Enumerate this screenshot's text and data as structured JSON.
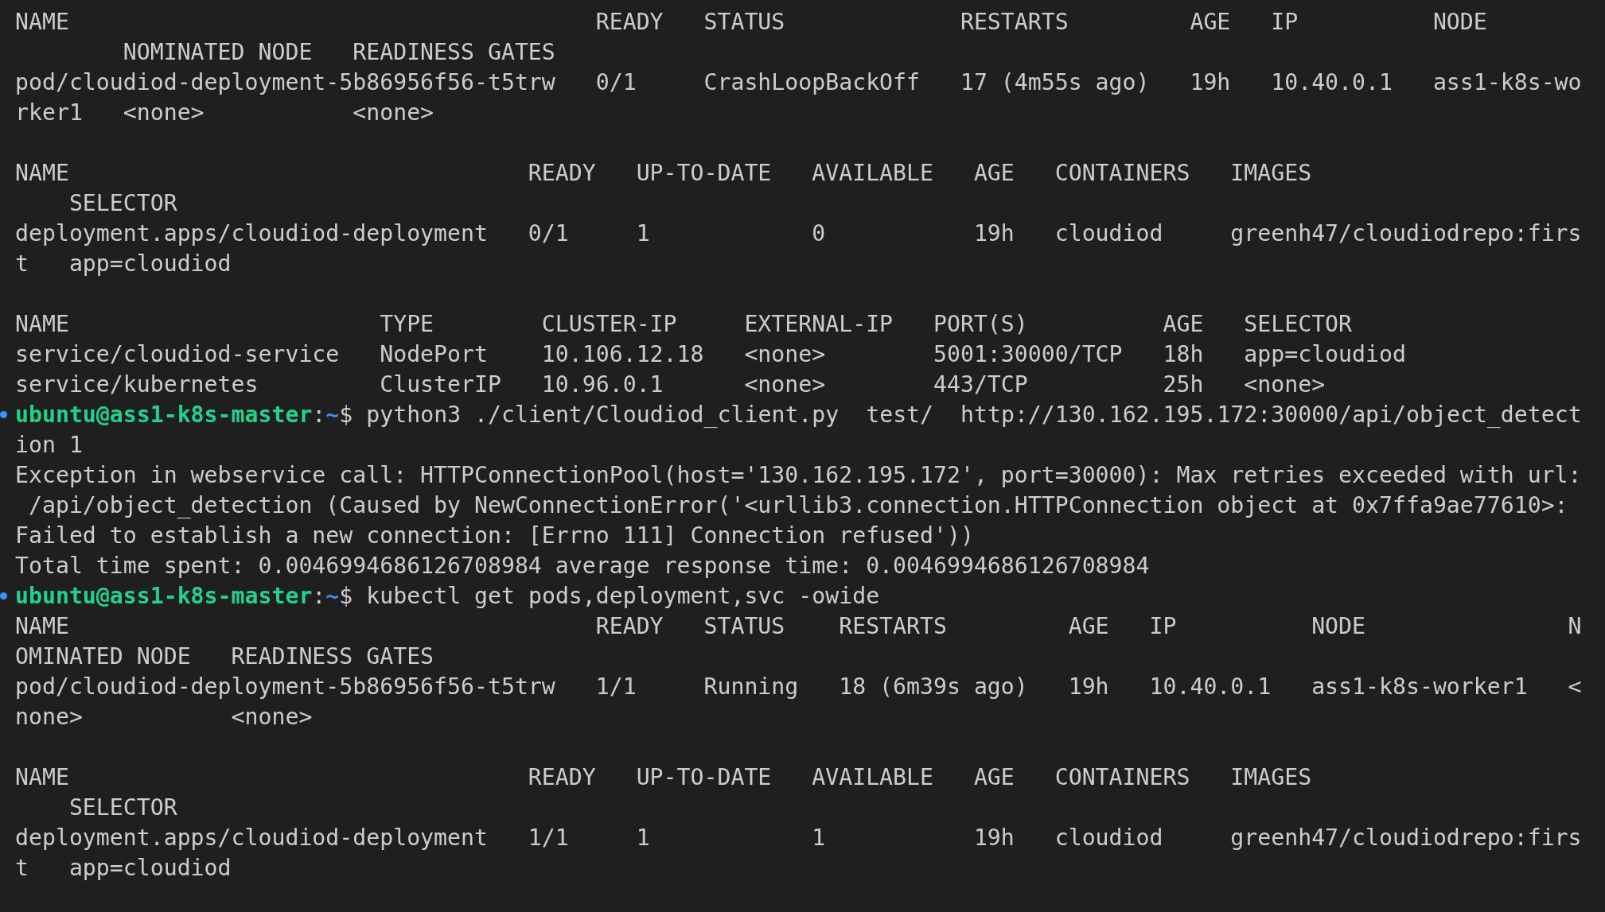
{
  "terminal": {
    "lines": [
      {
        "kind": "output",
        "text": "NAME                                       READY   STATUS             RESTARTS         AGE   IP          NODE"
      },
      {
        "kind": "output",
        "text": "        NOMINATED NODE   READINESS GATES"
      },
      {
        "kind": "output",
        "text": "pod/cloudiod-deployment-5b86956f56-t5trw   0/1     CrashLoopBackOff   17 (4m55s ago)   19h   10.40.0.1   ass1-k8s-wo"
      },
      {
        "kind": "output",
        "text": "rker1   <none>           <none>"
      },
      {
        "kind": "blank"
      },
      {
        "kind": "output",
        "text": "NAME                                  READY   UP-TO-DATE   AVAILABLE   AGE   CONTAINERS   IMAGES"
      },
      {
        "kind": "output",
        "text": "    SELECTOR"
      },
      {
        "kind": "output",
        "text": "deployment.apps/cloudiod-deployment   0/1     1            0           19h   cloudiod     greenh47/cloudiodrepo:firs"
      },
      {
        "kind": "output",
        "text": "t   app=cloudiod"
      },
      {
        "kind": "blank"
      },
      {
        "kind": "output",
        "text": "NAME                       TYPE        CLUSTER-IP     EXTERNAL-IP   PORT(S)          AGE   SELECTOR"
      },
      {
        "kind": "output",
        "text": "service/cloudiod-service   NodePort    10.106.12.18   <none>        5001:30000/TCP   18h   app=cloudiod"
      },
      {
        "kind": "output",
        "text": "service/kubernetes         ClusterIP   10.96.0.1      <none>        443/TCP          25h   <none>"
      },
      {
        "kind": "prompt",
        "user": "ubuntu@ass1-k8s-master",
        "separator": ":",
        "path": "~",
        "symbol": "$",
        "command": "python3 ./client/Cloudiod_client.py  test/  http://130.162.195.172:30000/api/object_detect"
      },
      {
        "kind": "output",
        "text": "ion 1"
      },
      {
        "kind": "output",
        "text": "Exception in webservice call: HTTPConnectionPool(host='130.162.195.172', port=30000): Max retries exceeded with url:"
      },
      {
        "kind": "output",
        "text": " /api/object_detection (Caused by NewConnectionError('<urllib3.connection.HTTPConnection object at 0x7ffa9ae77610>:"
      },
      {
        "kind": "output",
        "text": "Failed to establish a new connection: [Errno 111] Connection refused'))"
      },
      {
        "kind": "output",
        "text": "Total time spent: 0.0046994686126708984 average response time: 0.0046994686126708984"
      },
      {
        "kind": "prompt",
        "user": "ubuntu@ass1-k8s-master",
        "separator": ":",
        "path": "~",
        "symbol": "$",
        "command": "kubectl get pods,deployment,svc -owide"
      },
      {
        "kind": "output",
        "text": "NAME                                       READY   STATUS    RESTARTS         AGE   IP          NODE               N"
      },
      {
        "kind": "output",
        "text": "OMINATED NODE   READINESS GATES"
      },
      {
        "kind": "output",
        "text": "pod/cloudiod-deployment-5b86956f56-t5trw   1/1     Running   18 (6m39s ago)   19h   10.40.0.1   ass1-k8s-worker1   <"
      },
      {
        "kind": "output",
        "text": "none>           <none>"
      },
      {
        "kind": "blank"
      },
      {
        "kind": "output",
        "text": "NAME                                  READY   UP-TO-DATE   AVAILABLE   AGE   CONTAINERS   IMAGES"
      },
      {
        "kind": "output",
        "text": "    SELECTOR"
      },
      {
        "kind": "output",
        "text": "deployment.apps/cloudiod-deployment   1/1     1            1           19h   cloudiod     greenh47/cloudiodrepo:firs"
      },
      {
        "kind": "output",
        "text": "t   app=cloudiod"
      }
    ]
  }
}
